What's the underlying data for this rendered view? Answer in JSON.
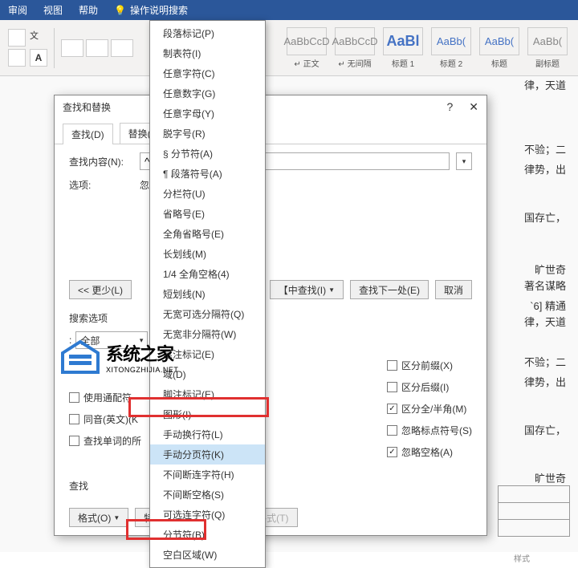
{
  "ribbon": {
    "tabs": [
      "审阅",
      "视图",
      "帮助"
    ],
    "tell_me": "操作说明搜索"
  },
  "styles": [
    {
      "thumb": "AaBbCcD",
      "label": "↵ 正文"
    },
    {
      "thumb": "AaBbCcD",
      "label": "↵ 无间隔"
    },
    {
      "thumb": "AaBl",
      "label": "标题 1",
      "big": true,
      "blue": true
    },
    {
      "thumb": "AaBb(",
      "label": "标题 2",
      "blue": true
    },
    {
      "thumb": "AaBb(",
      "label": "标题",
      "blue": true
    },
    {
      "thumb": "AaBb(",
      "label": "副标题"
    }
  ],
  "styles_caption": "样式",
  "doc_text": {
    "l1": "律，天道",
    "l2": "不验；二",
    "l3": "律势，出",
    "l4": "国存亡，",
    "l5": "旷世奇",
    "l6": "著名谋略",
    "l7": "`6] 精通",
    "l8": "律，天道",
    "l9": "不验；二",
    "l10": "律势，出",
    "l11": "国存亡，",
    "l12": "旷世奇"
  },
  "dialog": {
    "title": "查找和替换",
    "tabs": {
      "find": "查找(D)",
      "replace": "替换(P"
    },
    "find_label": "查找内容(N):",
    "find_value": "^n",
    "options_label": "选项:",
    "options_value": "忽",
    "less_btn": "<< 更少(L)",
    "find_in_btn": "【中查找(I)",
    "find_next_btn": "查找下一处(E)",
    "cancel_btn": "取消",
    "search_options_label": "搜索选项",
    "search_dir_label": ":",
    "search_dir_value": "全部",
    "checks_left": [
      {
        "label": "使用通配符",
        "checked": false
      },
      {
        "label": "同音(英文)(K",
        "checked": false
      },
      {
        "label": "查找单词的所",
        "checked": false
      }
    ],
    "checks_right": [
      {
        "label": "区分前缀(X)",
        "checked": false
      },
      {
        "label": "区分后缀(I)",
        "checked": false
      },
      {
        "label": "区分全/半角(M)",
        "checked": true
      },
      {
        "label": "忽略标点符号(S)",
        "checked": false
      },
      {
        "label": "忽略空格(A)",
        "checked": true
      }
    ],
    "find_section_label": "查找",
    "format_btn": "格式(O)",
    "special_btn": "特殊格式(E)",
    "noformat_btn": "不限定格式(T)"
  },
  "special_menu": [
    "段落标记(P)",
    "制表符(I)",
    "任意字符(C)",
    "任意数字(G)",
    "任意字母(Y)",
    "脱字号(R)",
    "§ 分节符(A)",
    "¶ 段落符号(A)",
    "分栏符(U)",
    "省略号(E)",
    "全角省略号(E)",
    "长划线(M)",
    "1/4 全角空格(4)",
    "短划线(N)",
    "无宽可选分隔符(Q)",
    "无宽非分隔符(W)",
    "尾注标记(E)",
    "域(D)",
    "脚注标记(E)",
    "图形(I)",
    "手动换行符(L)",
    "手动分页符(K)",
    "不间断连字符(H)",
    "不间断空格(S)",
    "可选连字符(Q)",
    "分节符(B)",
    "空白区域(W)"
  ],
  "highlighted_index": 21,
  "watermark": {
    "big": "系统之家",
    "small": "XITONGZHIJIA.NET"
  }
}
